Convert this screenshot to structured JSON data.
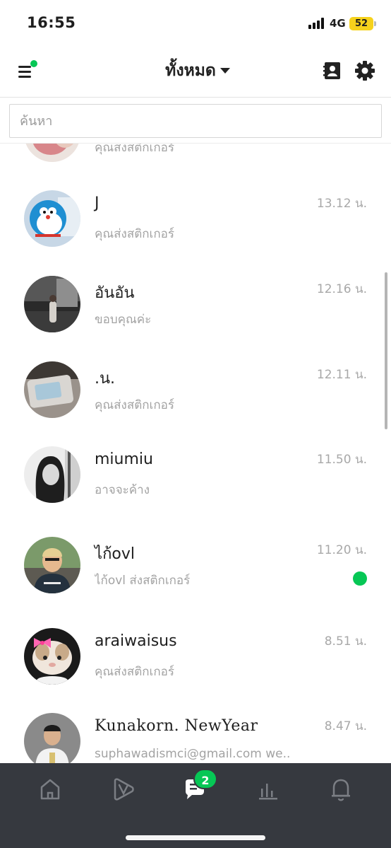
{
  "status_bar": {
    "time": "16:55",
    "network": "4G",
    "battery": "52"
  },
  "header": {
    "title": "ทั้งหมด",
    "menu_icon": "hamburger-menu-icon",
    "contacts_icon": "contact-card-icon",
    "settings_icon": "gear-icon",
    "accent_color": "#06c755"
  },
  "search": {
    "placeholder": "ค้นหา",
    "value": ""
  },
  "chats": [
    {
      "name": "",
      "message": "คุณส่งสติกเกอร์",
      "time": "",
      "unread": false
    },
    {
      "name": "J",
      "message": "คุณส่งสติกเกอร์",
      "time": "13.12 น.",
      "unread": false
    },
    {
      "name": "อันอัน",
      "message": "ขอบคุณค่ะ",
      "time": "12.16 น.",
      "unread": false
    },
    {
      "name": ".น.",
      "message": "คุณส่งสติกเกอร์",
      "time": "12.11 น.",
      "unread": false
    },
    {
      "name": "miumiu",
      "message": "อาจจะค้าง",
      "time": "11.50 น.",
      "unread": false
    },
    {
      "name": "ไก้ovl",
      "message": "ไก้ovl ส่งสติกเกอร์",
      "time": "11.20 น.",
      "unread": true
    },
    {
      "name": "araiwaisus",
      "message": "คุณส่งสติกเกอร์",
      "time": "8.51 น.",
      "unread": false
    },
    {
      "name": "Kunakorn. NewYear",
      "message": "suphawadismci@gmail.com we..",
      "time": "8.47 น.",
      "unread": false
    }
  ],
  "bottom_nav": {
    "items": [
      "home-icon",
      "voom-play-icon",
      "chat-bubble-icon",
      "stats-chart-icon",
      "bell-icon"
    ],
    "chat_badge": "2",
    "active": "chat-bubble-icon"
  }
}
